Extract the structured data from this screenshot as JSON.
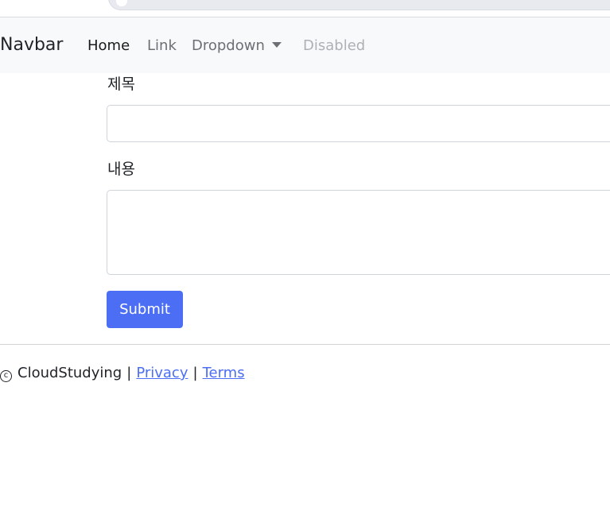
{
  "navbar": {
    "brand": "Navbar",
    "items": [
      {
        "label": "Home",
        "state": "active"
      },
      {
        "label": "Link",
        "state": "normal"
      },
      {
        "label": "Dropdown",
        "state": "normal"
      },
      {
        "label": "Disabled",
        "state": "disabled"
      }
    ]
  },
  "form": {
    "title_label": "제목",
    "title_value": "",
    "content_label": "내용",
    "content_value": "",
    "submit_label": "Submit"
  },
  "footer": {
    "copyright_icon": "copyright-icon",
    "copyright_glyph": "c",
    "company": "CloudStudying",
    "separator": "|",
    "privacy": "Privacy",
    "terms": "Terms"
  },
  "colors": {
    "accent": "#4c6ef5",
    "navbar_bg": "#f8f9fa",
    "border": "#ced4da"
  }
}
